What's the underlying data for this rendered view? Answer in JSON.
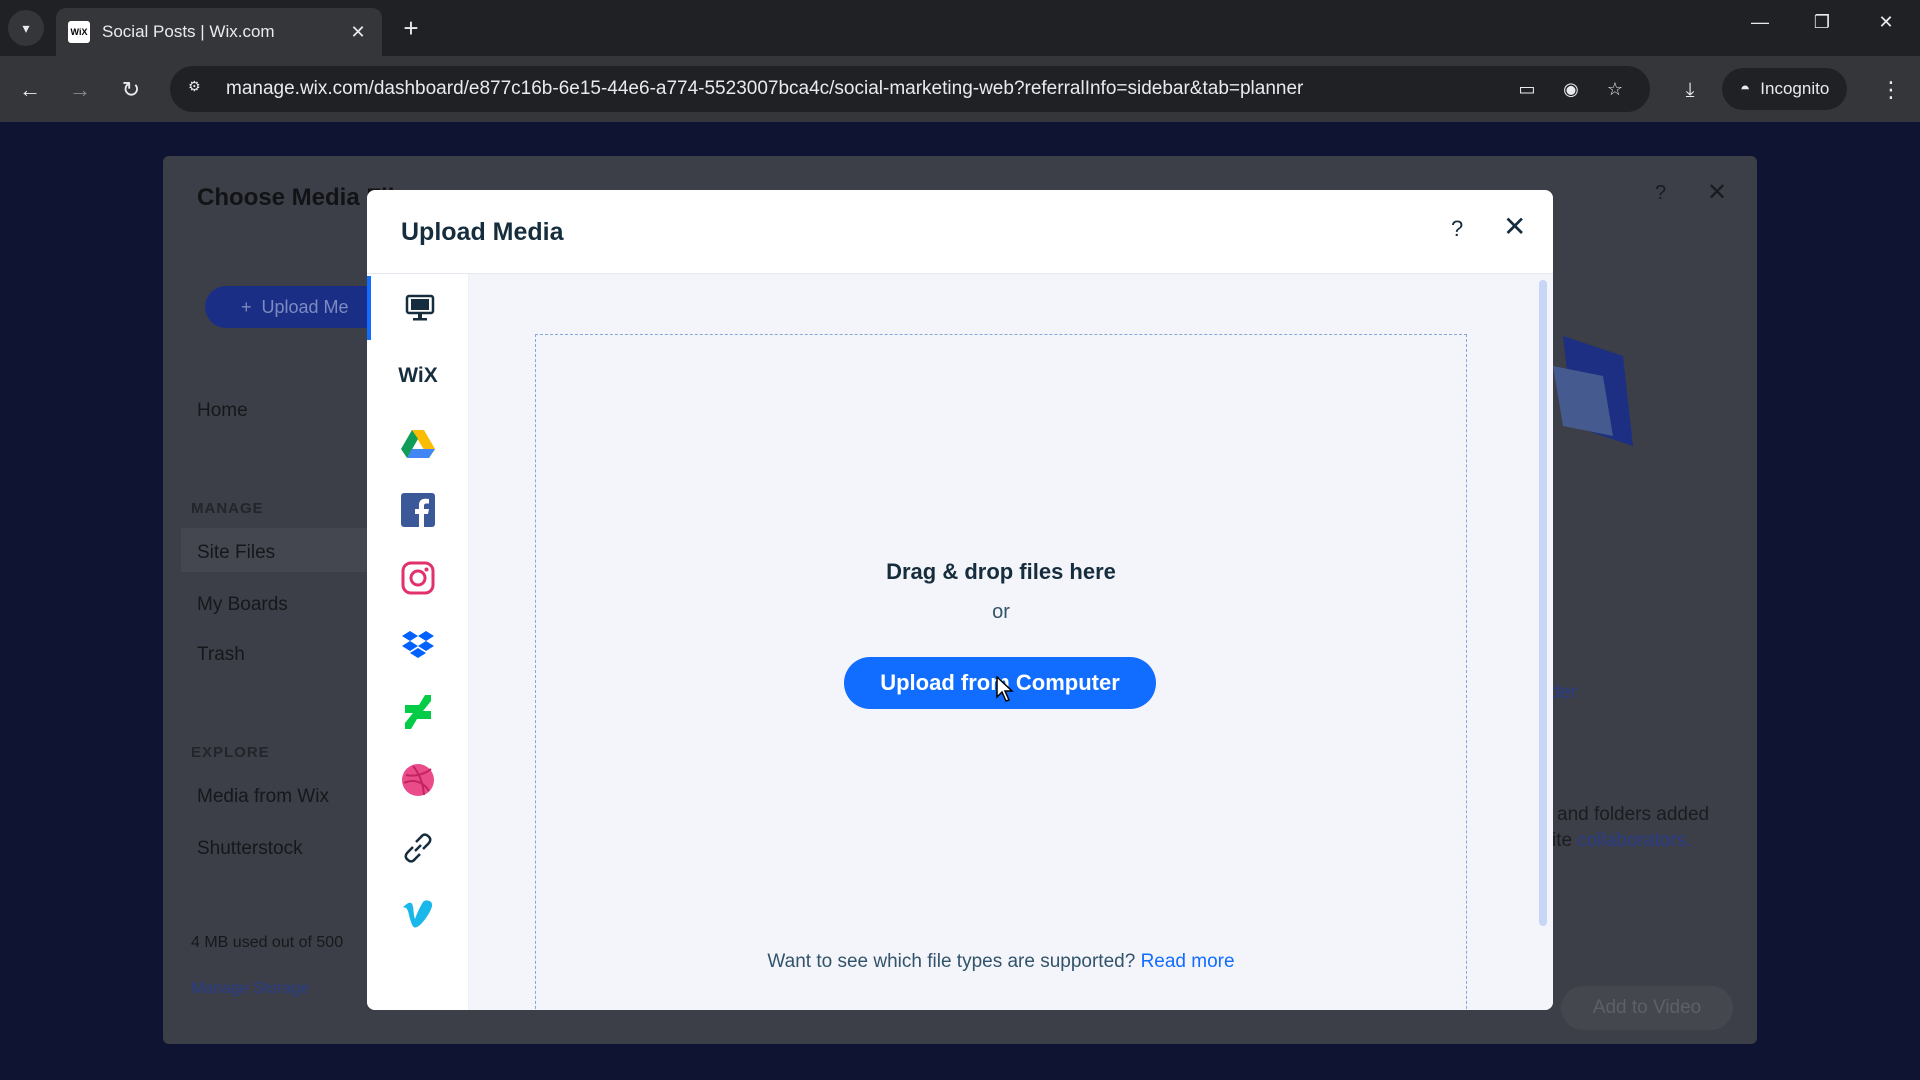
{
  "browser": {
    "tab_title": "Social Posts | Wix.com",
    "favicon_text": "WiX",
    "url": "manage.wix.com/dashboard/e877c16b-6e15-44e6-a774-5523007bca4c/social-marketing-web?referralInfo=sidebar&tab=planner",
    "incognito_label": "Incognito"
  },
  "choose_media": {
    "title": "Choose Media Fil",
    "upload_button": "Upload Me",
    "nav": {
      "home": "Home",
      "manage_heading": "MANAGE",
      "site_files": "Site Files",
      "my_boards": "My Boards",
      "trash": "Trash",
      "explore_heading": "EXPLORE",
      "media_from_wix": "Media from Wix",
      "shutterstock": "Shutterstock"
    },
    "storage_text": "4 MB used out of 500",
    "manage_storage": "Manage Storage",
    "right_fragment_1": "lder",
    "right_fragment_2": "and folders added",
    "right_fragment_3_prefix": "ite ",
    "right_fragment_3_link": "collaborators.",
    "add_button": "Add to Video"
  },
  "upload_media": {
    "title": "Upload Media",
    "help": "?",
    "sources": [
      "computer-icon",
      "wix-icon",
      "google-drive-icon",
      "facebook-icon",
      "instagram-icon",
      "dropbox-icon",
      "deviantart-icon",
      "dribbble-icon",
      "link-icon",
      "vimeo-icon"
    ],
    "wix_label": "WiX",
    "drag_text": "Drag & drop files here",
    "or_text": "or",
    "upload_button": "Upload from Computer",
    "filetypes_text": "Want to see which file types are supported?",
    "read_more": "Read more"
  },
  "colors": {
    "accent": "#116dff",
    "text_dark": "#162d3d",
    "page_background": "#0e1431"
  }
}
